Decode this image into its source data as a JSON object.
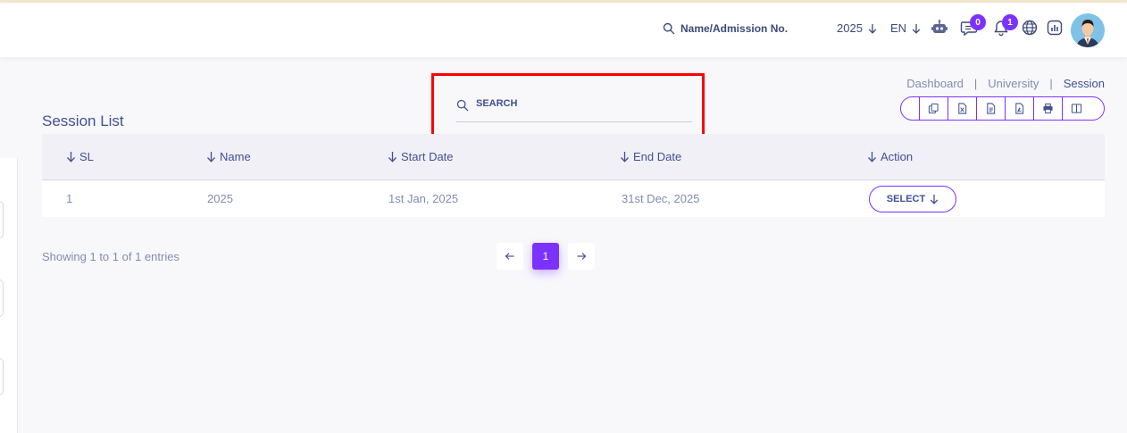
{
  "header": {
    "search_label": "Name/Admission No.",
    "session_value": "2025",
    "language_value": "EN",
    "chat_badge": "0",
    "notification_badge": "1"
  },
  "search": {
    "placeholder": "SEARCH"
  },
  "breadcrumb": {
    "items": [
      "Dashboard",
      "University",
      "Session"
    ],
    "separator": "|"
  },
  "page": {
    "title": "Session List"
  },
  "table": {
    "columns": [
      "SL",
      "Name",
      "Start Date",
      "End Date",
      "Action"
    ],
    "rows": [
      {
        "sl": "1",
        "name": "2025",
        "start_date": "1st Jan, 2025",
        "end_date": "31st Dec, 2025",
        "action_label": "SELECT"
      }
    ]
  },
  "pagination": {
    "info": "Showing 1 to 1 of 1 entries",
    "current_page": "1"
  },
  "colors": {
    "accent": "#7c32ff",
    "text": "#415094",
    "muted": "#828bb2",
    "highlight_border": "#ff0000"
  },
  "icons": {
    "header": [
      "search-icon",
      "chevron-down-icon",
      "robot-icon",
      "chat-icon",
      "bell-icon",
      "globe-icon",
      "chart-icon"
    ],
    "export": [
      "copy-icon",
      "excel-icon",
      "csv-icon",
      "pdf-icon",
      "print-icon",
      "columns-icon"
    ]
  }
}
